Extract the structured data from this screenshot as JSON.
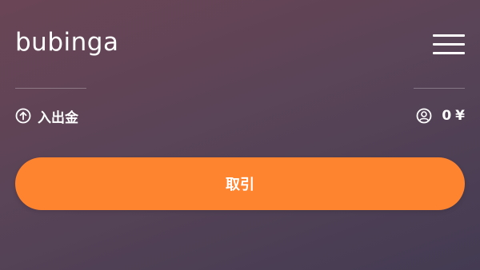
{
  "header": {
    "logo_text": "bubinga"
  },
  "account": {
    "deposit_label": "入出金",
    "balance_amount": "0",
    "balance_currency": "¥"
  },
  "actions": {
    "trade_label": "取引",
    "trade_color": "#ff842f"
  },
  "icons": {
    "menu": "hamburger-menu-icon",
    "deposit": "arrow-up-circle-icon",
    "user": "user-circle-icon"
  }
}
